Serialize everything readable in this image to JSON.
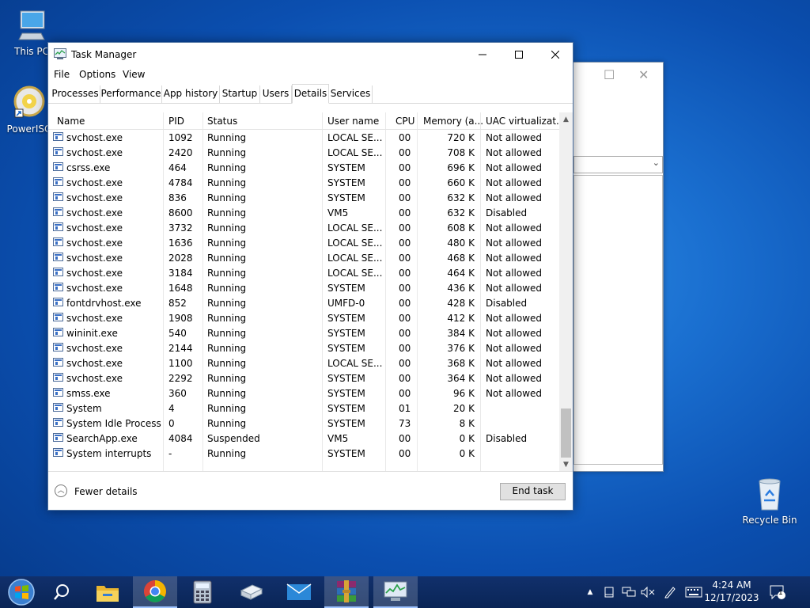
{
  "desktop": {
    "icons": [
      {
        "label": "This PC"
      },
      {
        "label": "PowerISO"
      },
      {
        "label": "Recycle Bin"
      }
    ]
  },
  "window": {
    "title": "Task Manager",
    "controls": {
      "minimize": "—",
      "maximize": "☐",
      "close": "✕"
    }
  },
  "menu": [
    "File",
    "Options",
    "View"
  ],
  "tabs": [
    {
      "label": "Processes",
      "active": false
    },
    {
      "label": "Performance",
      "active": false
    },
    {
      "label": "App history",
      "active": false
    },
    {
      "label": "Startup",
      "active": false
    },
    {
      "label": "Users",
      "active": false
    },
    {
      "label": "Details",
      "active": true
    },
    {
      "label": "Services",
      "active": false
    }
  ],
  "columns": [
    "Name",
    "PID",
    "Status",
    "User name",
    "CPU",
    "Memory (a...",
    "UAC virtualizat..."
  ],
  "rows": [
    [
      "svchost.exe",
      "1092",
      "Running",
      "LOCAL SE...",
      "00",
      "720 K",
      "Not allowed"
    ],
    [
      "svchost.exe",
      "2420",
      "Running",
      "LOCAL SE...",
      "00",
      "708 K",
      "Not allowed"
    ],
    [
      "csrss.exe",
      "464",
      "Running",
      "SYSTEM",
      "00",
      "696 K",
      "Not allowed"
    ],
    [
      "svchost.exe",
      "4784",
      "Running",
      "SYSTEM",
      "00",
      "660 K",
      "Not allowed"
    ],
    [
      "svchost.exe",
      "836",
      "Running",
      "SYSTEM",
      "00",
      "632 K",
      "Not allowed"
    ],
    [
      "svchost.exe",
      "8600",
      "Running",
      "VM5",
      "00",
      "632 K",
      "Disabled"
    ],
    [
      "svchost.exe",
      "3732",
      "Running",
      "LOCAL SE...",
      "00",
      "608 K",
      "Not allowed"
    ],
    [
      "svchost.exe",
      "1636",
      "Running",
      "LOCAL SE...",
      "00",
      "480 K",
      "Not allowed"
    ],
    [
      "svchost.exe",
      "2028",
      "Running",
      "LOCAL SE...",
      "00",
      "468 K",
      "Not allowed"
    ],
    [
      "svchost.exe",
      "3184",
      "Running",
      "LOCAL SE...",
      "00",
      "464 K",
      "Not allowed"
    ],
    [
      "svchost.exe",
      "1648",
      "Running",
      "SYSTEM",
      "00",
      "436 K",
      "Not allowed"
    ],
    [
      "fontdrvhost.exe",
      "852",
      "Running",
      "UMFD-0",
      "00",
      "428 K",
      "Disabled"
    ],
    [
      "svchost.exe",
      "1908",
      "Running",
      "SYSTEM",
      "00",
      "412 K",
      "Not allowed"
    ],
    [
      "wininit.exe",
      "540",
      "Running",
      "SYSTEM",
      "00",
      "384 K",
      "Not allowed"
    ],
    [
      "svchost.exe",
      "2144",
      "Running",
      "SYSTEM",
      "00",
      "376 K",
      "Not allowed"
    ],
    [
      "svchost.exe",
      "1100",
      "Running",
      "LOCAL SE...",
      "00",
      "368 K",
      "Not allowed"
    ],
    [
      "svchost.exe",
      "2292",
      "Running",
      "SYSTEM",
      "00",
      "364 K",
      "Not allowed"
    ],
    [
      "smss.exe",
      "360",
      "Running",
      "SYSTEM",
      "00",
      "96 K",
      "Not allowed"
    ],
    [
      "System",
      "4",
      "Running",
      "SYSTEM",
      "01",
      "20 K",
      ""
    ],
    [
      "System Idle Process",
      "0",
      "Running",
      "SYSTEM",
      "73",
      "8 K",
      ""
    ],
    [
      "SearchApp.exe",
      "4084",
      "Suspended",
      "VM5",
      "00",
      "0 K",
      "Disabled"
    ],
    [
      "System interrupts",
      "-",
      "Running",
      "SYSTEM",
      "00",
      "0 K",
      ""
    ]
  ],
  "footer": {
    "fewer_details": "Fewer details",
    "end_task": "End task"
  },
  "taskbar": {
    "apps": [
      "start-icon",
      "search-icon",
      "file-explorer-icon",
      "chrome-icon",
      "calculator-icon",
      "drive-icon",
      "mail-icon",
      "winrar-icon",
      "task-manager-icon"
    ],
    "tray_icons": [
      "chevron-up-icon",
      "tablet-icon",
      "network-icon",
      "volume-muted-icon",
      "pen-icon",
      "keyboard-icon"
    ],
    "time": "4:24 AM",
    "date": "12/17/2023",
    "notifications_count": "1"
  },
  "colors": {
    "accent": "#0078d7",
    "selection_tab_border": "#d9d9d9"
  }
}
